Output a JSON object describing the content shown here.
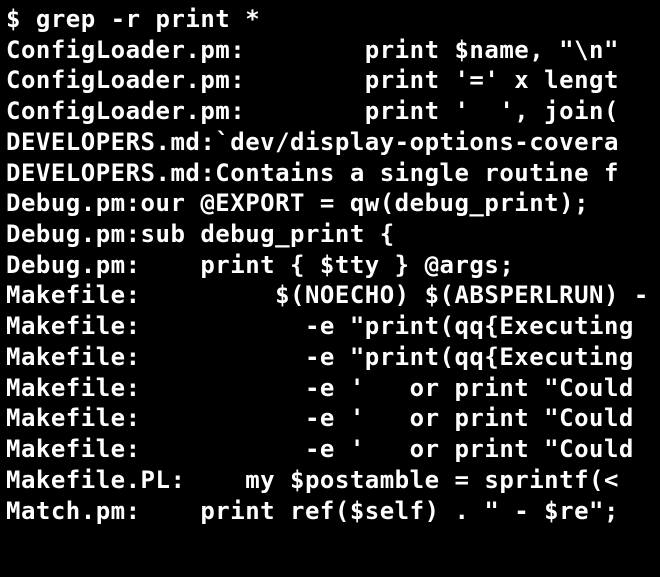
{
  "prompt": "$ ",
  "command": "grep -r print *",
  "output_lines": [
    "ConfigLoader.pm:        print $name, \"\\n\"",
    "ConfigLoader.pm:        print '=' x lengt",
    "ConfigLoader.pm:        print '  ', join(",
    "DEVELOPERS.md:`dev/display-options-covera",
    "DEVELOPERS.md:Contains a single routine f",
    "Debug.pm:our @EXPORT = qw(debug_print);",
    "Debug.pm:sub debug_print {",
    "Debug.pm:    print { $tty } @args;",
    "Makefile:\t  $(NOECHO) $(ABSPERLRUN) -",
    "Makefile:\t    -e \"print(qq{Executing ",
    "Makefile:\t    -e \"print(qq{Executing ",
    "Makefile:\t    -e '   or print \"Could",
    "Makefile:\t    -e '   or print \"Could",
    "Makefile:\t    -e '   or print \"Could",
    "Makefile.PL:    my $postamble = sprintf(<",
    "Match.pm:    print ref($self) . \" - $re\";"
  ]
}
